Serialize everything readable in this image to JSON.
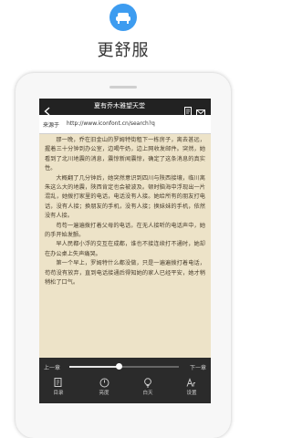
{
  "promo": {
    "icon": "sofa-icon",
    "icon_color": "#3d9cf0",
    "title": "更舒服"
  },
  "reader": {
    "header": {
      "title": "夏有乔木雅望天堂",
      "back_icon": "back-arrow-icon",
      "bookmark_icon": "bookmark-icon",
      "share_icon": "mail-icon"
    },
    "source": {
      "label": "来源于",
      "url": "http://www.iconfont.cn/search?q"
    },
    "paragraphs": [
      "那一晚，乔在旧金山的罗姆特街租下一栋房子，离去甚远，握着三十分钟到办公室，边喝牛奶，边上网收发邮件。突然，她看到了北川地震的消息，震惊新闻震惊，确定了这条消息的真实性。",
      "大概翻了几分钟后，她突然意识到四川与陕西接壤，临川离朱这么大的地震，陕西肯定也会被波及。顿时脑海中浮现出一片混乱，她拨打家里的电话，电话没有人接。她给所有的朋友打电话，没有人接；换朋友的手机，没有人接；换妹妹的手机，依然没有人接。",
      "苟苟一遍遍拨打着父母的电话，在无人接听的电话声中，她的手开始发颤。",
      "早人民都小浮的交互在成都，谁也不接连续打不通时，她却在办公桌上失声痛哭。",
      "第一个早上，罗姆特什么都没做，只是一遍遍拨打着电话，苟苟没有放弃，直到电话接通后得知她的家人已经平安，她才稍稍松了口气。"
    ],
    "footer": {
      "prev_label": "上一章",
      "next_label": "下一章",
      "progress_percent": 45,
      "tools": [
        {
          "label": "目录",
          "icon": "catalog-icon"
        },
        {
          "label": "亮度",
          "icon": "brightness-icon"
        },
        {
          "label": "白天",
          "icon": "day-mode-icon"
        },
        {
          "label": "设置",
          "icon": "font-settings-icon"
        }
      ]
    }
  }
}
